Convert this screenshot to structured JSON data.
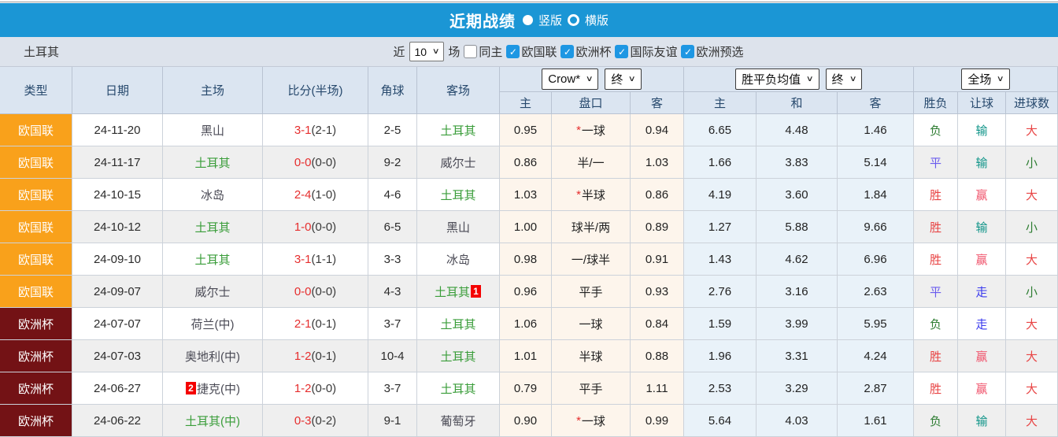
{
  "icons": {
    "check": "✓",
    "chevron_down": "∨"
  },
  "colors": {
    "header_blue": "#1b96d5",
    "filter_bg": "#dde3ec",
    "table_header_bg": "#dbe5f1",
    "nations_league_orange": "#f9a11b",
    "euro_cup_maroon": "#731215",
    "crow_odds_bg": "#fdf5ec",
    "avg_odds_bg": "#e9f2f9",
    "win_red": "#e84444",
    "draw_violet": "#6a5bee",
    "loss_green": "#2e7d32",
    "cover_pink": "#f0566e",
    "lose_cover_teal": "#0f9488",
    "push_blue": "#3a3aee",
    "team_green": "#3a9d3a",
    "score_red": "#e62e2e",
    "red_card_badge": "#f40000"
  },
  "title_bar": {
    "title": "近期战绩",
    "vertical_option": "竖版",
    "horizontal_option": "横版",
    "selected_option": "竖版"
  },
  "filter_bar": {
    "team": "土耳其",
    "recent_label": "近",
    "recent_value": "10",
    "matches_label": "场",
    "options": [
      {
        "label": "同主",
        "checked": false
      },
      {
        "label": "欧国联",
        "checked": true
      },
      {
        "label": "欧洲杯",
        "checked": true
      },
      {
        "label": "国际友谊",
        "checked": true
      },
      {
        "label": "欧洲预选",
        "checked": true
      }
    ]
  },
  "table": {
    "main_headers": [
      "类型",
      "日期",
      "主场",
      "比分(半场)",
      "角球",
      "客场"
    ],
    "selects": {
      "odds_source": "Crow*",
      "odds_state": "终",
      "avg_source": "胜平负均值",
      "avg_state": "终",
      "result_scope": "全场"
    },
    "sub_headers": [
      "主",
      "盘口",
      "客",
      "主",
      "和",
      "客",
      "胜负",
      "让球",
      "进球数"
    ],
    "rows": [
      {
        "type": "欧国联",
        "date": "24-11-20",
        "home": "黑山",
        "score": "3-1",
        "half": "(2-1)",
        "corners": "2-5",
        "away": "土耳其",
        "odds_home": "0.95",
        "handicap_star": "*",
        "handicap": "一球",
        "odds_away": "0.94",
        "avg_home": "6.65",
        "avg_draw": "4.48",
        "avg_away": "1.46",
        "outcome": "负",
        "handicap_outcome": "输",
        "goals_outcome": "大"
      },
      {
        "type": "欧国联",
        "date": "24-11-17",
        "home": "土耳其",
        "score": "0-0",
        "half": "(0-0)",
        "corners": "9-2",
        "away": "威尔士",
        "odds_home": "0.86",
        "handicap": "半/一",
        "odds_away": "1.03",
        "avg_home": "1.66",
        "avg_draw": "3.83",
        "avg_away": "5.14",
        "outcome": "平",
        "handicap_outcome": "输",
        "goals_outcome": "小"
      },
      {
        "type": "欧国联",
        "date": "24-10-15",
        "home": "冰岛",
        "score": "2-4",
        "half": "(1-0)",
        "corners": "4-6",
        "away": "土耳其",
        "odds_home": "1.03",
        "handicap_star": "*",
        "handicap": "半球",
        "odds_away": "0.86",
        "avg_home": "4.19",
        "avg_draw": "3.60",
        "avg_away": "1.84",
        "outcome": "胜",
        "handicap_outcome": "赢",
        "goals_outcome": "大"
      },
      {
        "type": "欧国联",
        "date": "24-10-12",
        "home": "土耳其",
        "score": "1-0",
        "half": "(0-0)",
        "corners": "6-5",
        "away": "黑山",
        "odds_home": "1.00",
        "handicap": "球半/两",
        "odds_away": "0.89",
        "avg_home": "1.27",
        "avg_draw": "5.88",
        "avg_away": "9.66",
        "outcome": "胜",
        "handicap_outcome": "输",
        "goals_outcome": "小"
      },
      {
        "type": "欧国联",
        "date": "24-09-10",
        "home": "土耳其",
        "score": "3-1",
        "half": "(1-1)",
        "corners": "3-3",
        "away": "冰岛",
        "odds_home": "0.98",
        "handicap": "一/球半",
        "odds_away": "0.91",
        "avg_home": "1.43",
        "avg_draw": "4.62",
        "avg_away": "6.96",
        "outcome": "胜",
        "handicap_outcome": "赢",
        "goals_outcome": "大"
      },
      {
        "type": "欧国联",
        "date": "24-09-07",
        "home": "威尔士",
        "score": "0-0",
        "half": "(0-0)",
        "corners": "4-3",
        "away": "土耳其",
        "away_badge": "1",
        "odds_home": "0.96",
        "handicap": "平手",
        "odds_away": "0.93",
        "avg_home": "2.76",
        "avg_draw": "3.16",
        "avg_away": "2.63",
        "outcome": "平",
        "handicap_outcome": "走",
        "goals_outcome": "小"
      },
      {
        "type": "欧洲杯",
        "date": "24-07-07",
        "home": "荷兰(中)",
        "score": "2-1",
        "half": "(0-1)",
        "corners": "3-7",
        "away": "土耳其",
        "odds_home": "1.06",
        "handicap": "一球",
        "odds_away": "0.84",
        "avg_home": "1.59",
        "avg_draw": "3.99",
        "avg_away": "5.95",
        "outcome": "负",
        "handicap_outcome": "走",
        "goals_outcome": "大"
      },
      {
        "type": "欧洲杯",
        "date": "24-07-03",
        "home": "奥地利(中)",
        "score": "1-2",
        "half": "(0-1)",
        "corners": "10-4",
        "away": "土耳其",
        "odds_home": "1.01",
        "handicap": "半球",
        "odds_away": "0.88",
        "avg_home": "1.96",
        "avg_draw": "3.31",
        "avg_away": "4.24",
        "outcome": "胜",
        "handicap_outcome": "赢",
        "goals_outcome": "大"
      },
      {
        "type": "欧洲杯",
        "date": "24-06-27",
        "home": "捷克(中)",
        "home_badge": "2",
        "score": "1-2",
        "half": "(0-0)",
        "corners": "3-7",
        "away": "土耳其",
        "odds_home": "0.79",
        "handicap": "平手",
        "odds_away": "1.11",
        "avg_home": "2.53",
        "avg_draw": "3.29",
        "avg_away": "2.87",
        "outcome": "胜",
        "handicap_outcome": "赢",
        "goals_outcome": "大"
      },
      {
        "type": "欧洲杯",
        "date": "24-06-22",
        "home": "土耳其(中)",
        "score": "0-3",
        "half": "(0-2)",
        "corners": "9-1",
        "away": "葡萄牙",
        "odds_home": "0.90",
        "handicap_star": "*",
        "handicap": "一球",
        "odds_away": "0.99",
        "avg_home": "5.64",
        "avg_draw": "4.03",
        "avg_away": "1.61",
        "outcome": "负",
        "handicap_outcome": "输",
        "goals_outcome": "大"
      }
    ]
  }
}
